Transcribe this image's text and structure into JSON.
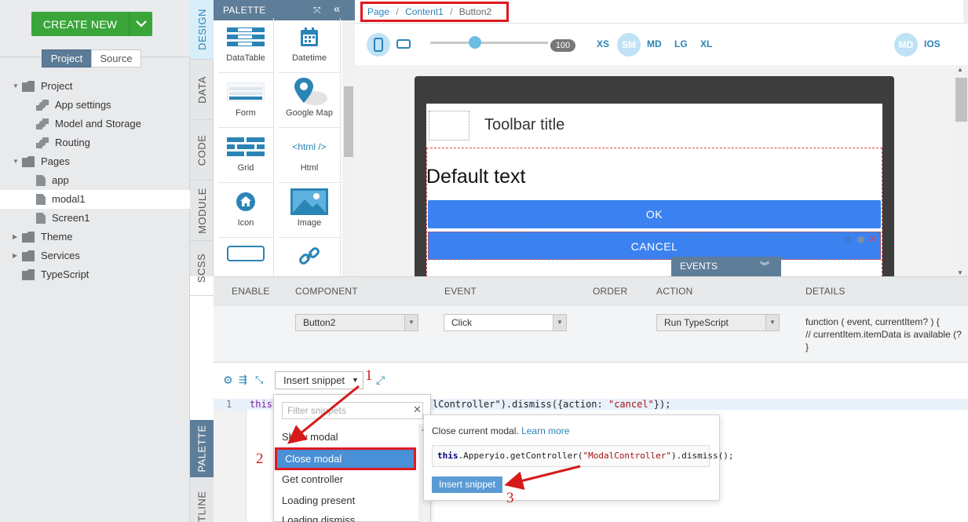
{
  "sidebar": {
    "create_label": "CREATE NEW",
    "tabs": {
      "project": "Project",
      "source": "Source"
    },
    "tree": [
      {
        "label": "Project"
      },
      {
        "label": "App settings"
      },
      {
        "label": "Model and Storage"
      },
      {
        "label": "Routing"
      },
      {
        "label": "Pages"
      },
      {
        "label": "app"
      },
      {
        "label": "modal1"
      },
      {
        "label": "Screen1"
      },
      {
        "label": "Theme"
      },
      {
        "label": "Services"
      },
      {
        "label": "TypeScript"
      }
    ]
  },
  "vertical_tabs": {
    "design": "DESIGN",
    "data": "DATA",
    "code": "CODE",
    "module": "MODULE",
    "scss": "SCSS",
    "palette": "PALETTE",
    "outline": "OUTLINE"
  },
  "palette": {
    "title": "PALETTE",
    "items": [
      {
        "label": "DataTable",
        "icon": "datatable-icon"
      },
      {
        "label": "Datetime",
        "icon": "calendar-icon"
      },
      {
        "label": "Form",
        "icon": "form-icon"
      },
      {
        "label": "Google Map",
        "icon": "map-pin-icon"
      },
      {
        "label": "Grid",
        "icon": "grid-icon"
      },
      {
        "label": "Html",
        "icon": "html-icon"
      },
      {
        "label": "Icon",
        "icon": "home-icon"
      },
      {
        "label": "Image",
        "icon": "image-icon"
      },
      {
        "label": "",
        "icon": "input-icon"
      },
      {
        "label": "",
        "icon": "link-icon"
      }
    ],
    "html_glyph": "<html />"
  },
  "breadcrumb": {
    "page": "Page",
    "sep": "/",
    "content": "Content1",
    "current": "Button2"
  },
  "toolbar": {
    "zoom": "100",
    "zoom_percent": 38,
    "breakpoints": [
      "XS",
      "SM",
      "MD",
      "LG",
      "XL"
    ],
    "selected_breakpoint": "SM",
    "platforms": [
      "MD",
      "IOS"
    ]
  },
  "preview": {
    "toolbar_title": "Toolbar title",
    "default_text": "Default text",
    "ok": "OK",
    "cancel": "CANCEL",
    "events_tab": "EVENTS"
  },
  "events": {
    "headers": [
      "ENABLE",
      "COMPONENT",
      "EVENT",
      "ORDER",
      "ACTION",
      "DETAILS"
    ],
    "row": {
      "component": "Button2",
      "event": "Click",
      "action": "Run TypeScript",
      "details": [
        "function ( event, currentItem? ) {",
        "// currentItem.itemData is available (?",
        "}"
      ]
    }
  },
  "editor": {
    "snippet_button": "Insert snippet",
    "line_number": "1",
    "code_kw": "this",
    "code_tail_a": "lController\").dismiss({action: ",
    "code_str": "\"cancel\"",
    "code_tail_b": "});"
  },
  "snippet_menu": {
    "filter_placeholder": "Filter snippets",
    "items": [
      "Show modal",
      "Close modal",
      "Get controller",
      "Loading present",
      "Loading dismiss"
    ]
  },
  "tooltip": {
    "text": "Close current modal.",
    "link": "Learn more",
    "code_kw": "this",
    "code_mid": ".Apperyio.getController(",
    "code_str": "\"ModalController\"",
    "code_end": ").dismiss();",
    "button": "Insert snippet"
  },
  "annotations": [
    "1",
    "2",
    "3"
  ],
  "colors": {
    "accent": "#2b84b6",
    "create": "#3aa63a",
    "highlight": "#e0191e",
    "button": "#3b82f0"
  }
}
